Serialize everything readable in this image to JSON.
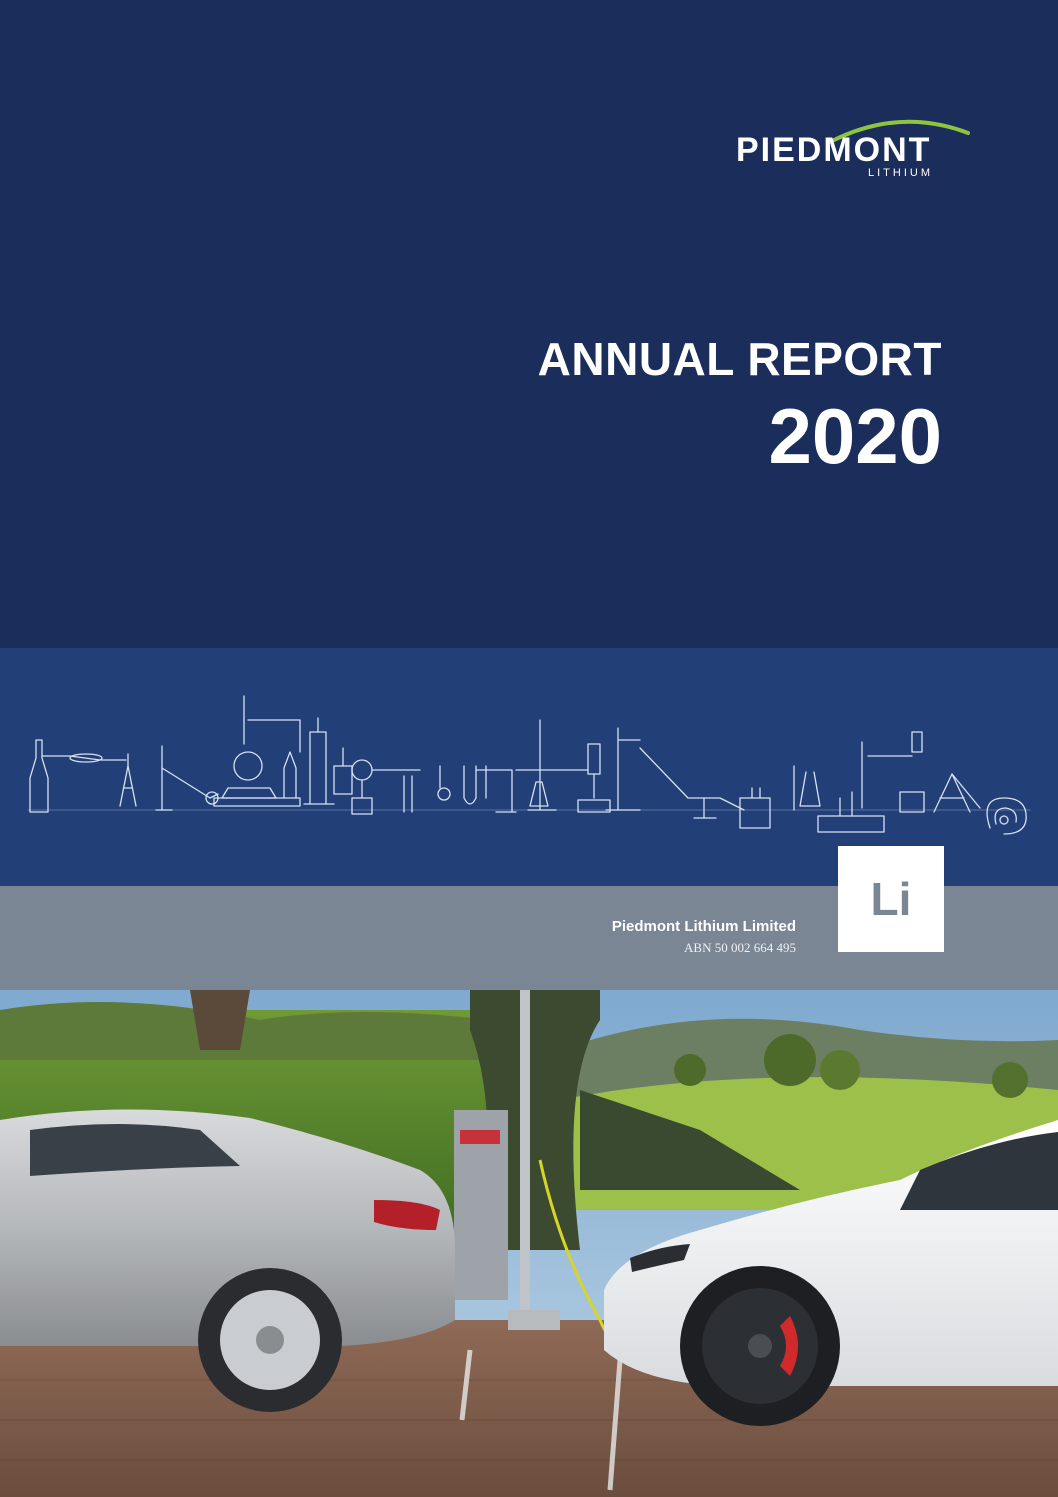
{
  "logo": {
    "word": "PIEDMONT",
    "sub": "LITHIUM"
  },
  "cover": {
    "title_line1": "ANNUAL REPORT",
    "title_line2": "2020"
  },
  "company": {
    "name": "Piedmont Lithium Limited",
    "abn": "ABN 50 002 664 495"
  },
  "element_box": {
    "symbol": "Li"
  },
  "colors": {
    "navy": "#1b2d5a",
    "band_blue": "#223f78",
    "grey": "#7a8694",
    "logo_green": "#8fc440"
  }
}
